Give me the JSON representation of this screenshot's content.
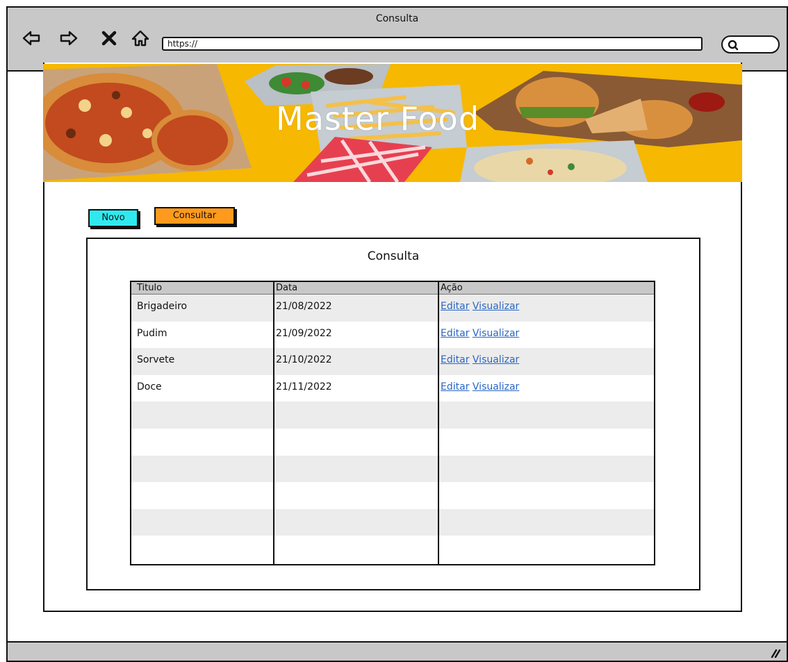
{
  "window": {
    "title": "Consulta"
  },
  "browser": {
    "url": "https://"
  },
  "banner": {
    "title": "Master Food"
  },
  "actions": {
    "novo": "Novo",
    "consultar": "Consultar"
  },
  "panel": {
    "title": "Consulta"
  },
  "table": {
    "headers": [
      "Titulo",
      "Data",
      "Ação"
    ],
    "rows": [
      {
        "titulo": "Brigadeiro",
        "data": "21/08/2022",
        "editar": "Editar",
        "visualizar": "Visualizar"
      },
      {
        "titulo": "Pudim",
        "data": "21/09/2022",
        "editar": "Editar",
        "visualizar": "Visualizar"
      },
      {
        "titulo": "Sorvete",
        "data": "21/10/2022",
        "editar": "Editar",
        "visualizar": "Visualizar"
      },
      {
        "titulo": "Doce",
        "data": "21/11/2022",
        "editar": "Editar",
        "visualizar": "Visualizar"
      }
    ],
    "empty_rows": 6
  },
  "colors": {
    "banner": "#f6b800",
    "novo": "#2fe9ee",
    "consultar": "#ff9a1c",
    "link": "#2a66c4"
  }
}
